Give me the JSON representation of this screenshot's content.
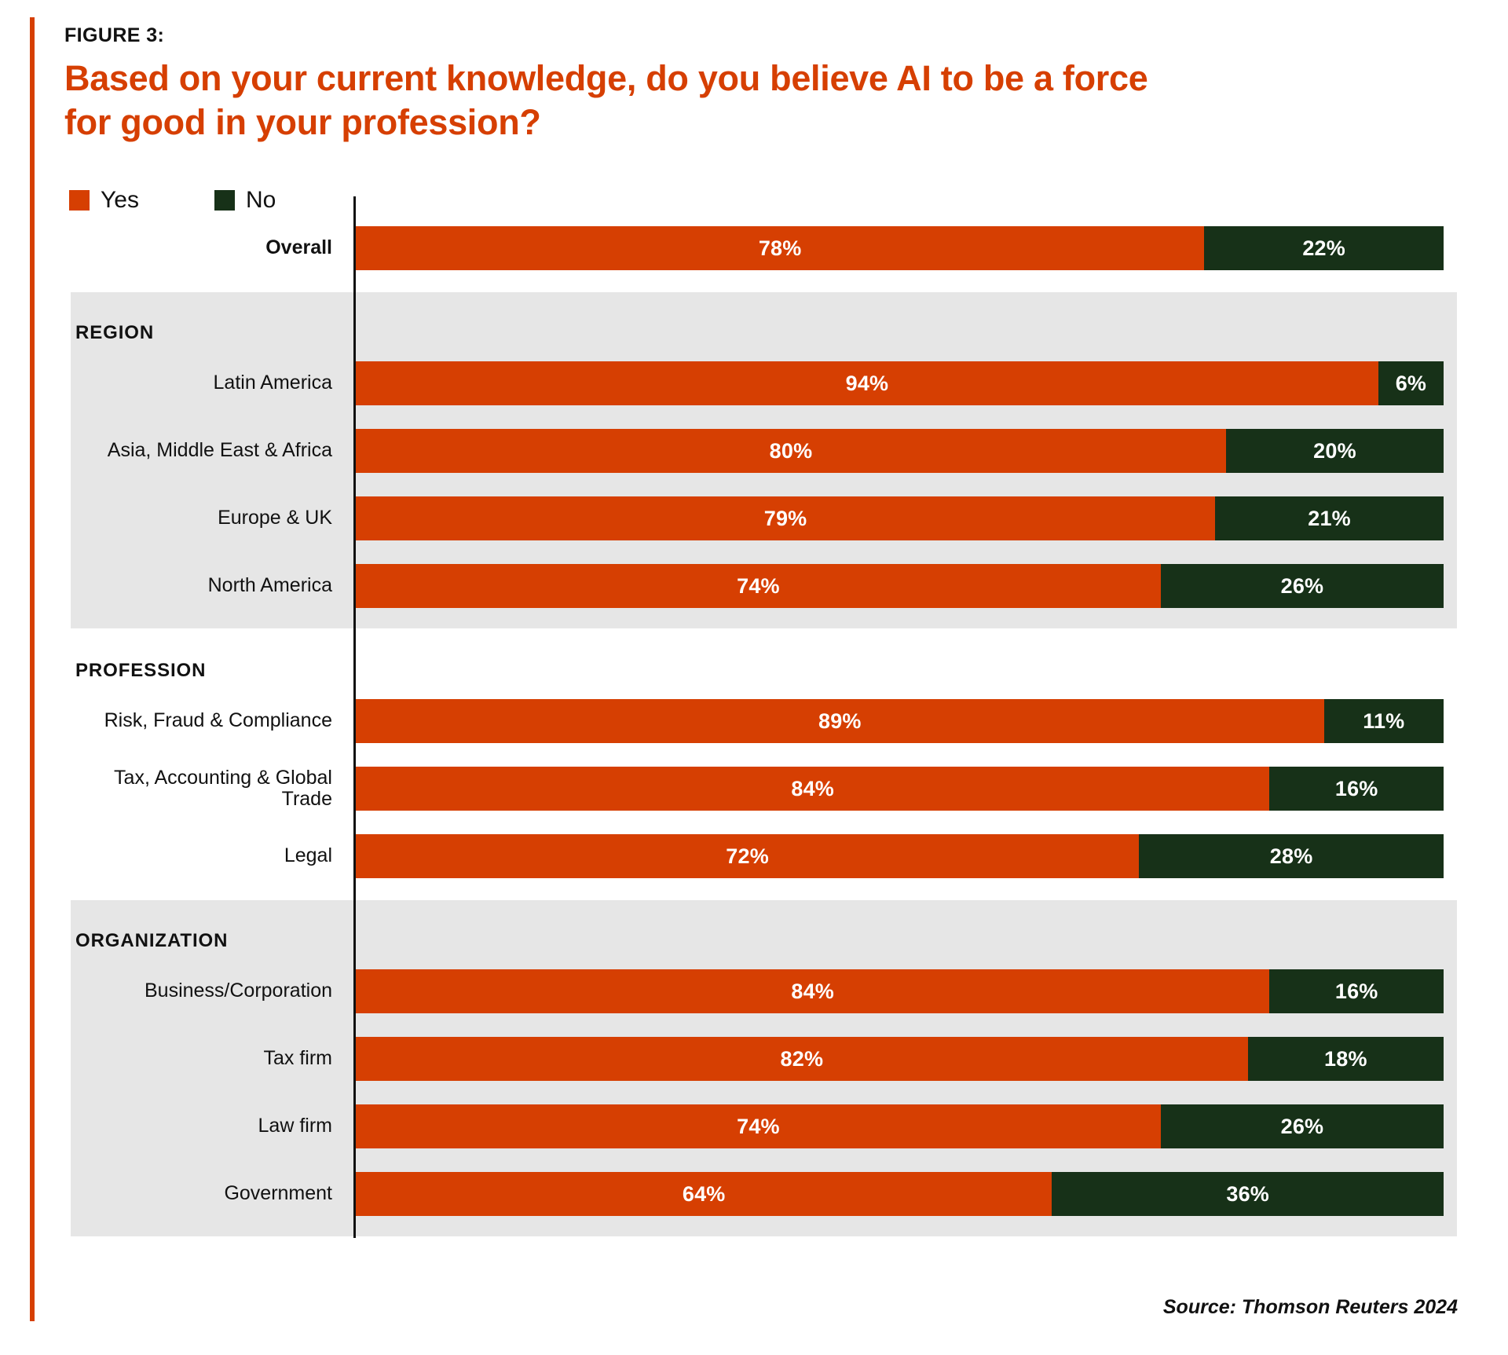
{
  "figure": {
    "kicker": "FIGURE 3:",
    "title": "Based on your current knowledge, do you believe AI to be a force for good in your profession?"
  },
  "legend": {
    "items": [
      {
        "label": "Yes",
        "color": "#D63F02",
        "swatch_name": "legend-swatch-yes"
      },
      {
        "label": "No",
        "color": "#173118",
        "swatch_name": "legend-swatch-no"
      }
    ]
  },
  "source": "Source: Thomson Reuters 2024",
  "colors": {
    "yes": "#D63F02",
    "no": "#173118",
    "accent": "#D63F02",
    "band": "#E6E6E6",
    "axis": "#111111"
  },
  "chart_data": {
    "type": "bar",
    "orientation": "horizontal",
    "stacked": true,
    "percent_stacked": true,
    "title": "Based on your current knowledge, do you believe AI to be a force for good in your profession?",
    "subtitle": "FIGURE 3:",
    "xlabel": "",
    "ylabel": "",
    "xlim": [
      0,
      100
    ],
    "grid": false,
    "legend_position": "top-left",
    "categories": [
      "Overall",
      "Latin America",
      "Asia, Middle East & Africa",
      "Europe & UK",
      "North America",
      "Risk, Fraud & Compliance",
      "Tax, Accounting & Global Trade",
      "Legal",
      "Business/Corporation",
      "Tax firm",
      "Law firm",
      "Government"
    ],
    "series": [
      {
        "name": "Yes",
        "color": "#D63F02",
        "values": [
          78,
          94,
          80,
          79,
          74,
          89,
          84,
          72,
          84,
          82,
          74,
          64
        ]
      },
      {
        "name": "No",
        "color": "#173118",
        "values": [
          22,
          6,
          20,
          21,
          26,
          11,
          16,
          28,
          16,
          18,
          26,
          36
        ]
      }
    ],
    "groups": [
      {
        "header": "",
        "shaded": false,
        "rows": [
          {
            "label": "Overall",
            "bold": true,
            "yes": 78,
            "no": 22,
            "yes_label": "78%",
            "no_label": "22%"
          }
        ]
      },
      {
        "header": "REGION",
        "shaded": true,
        "rows": [
          {
            "label": "Latin America",
            "bold": false,
            "yes": 94,
            "no": 6,
            "yes_label": "94%",
            "no_label": "6%"
          },
          {
            "label": "Asia, Middle East & Africa",
            "bold": false,
            "yes": 80,
            "no": 20,
            "yes_label": "80%",
            "no_label": "20%"
          },
          {
            "label": "Europe & UK",
            "bold": false,
            "yes": 79,
            "no": 21,
            "yes_label": "79%",
            "no_label": "21%"
          },
          {
            "label": "North America",
            "bold": false,
            "yes": 74,
            "no": 26,
            "yes_label": "74%",
            "no_label": "26%"
          }
        ]
      },
      {
        "header": "PROFESSION",
        "shaded": false,
        "rows": [
          {
            "label": "Risk, Fraud & Compliance",
            "bold": false,
            "yes": 89,
            "no": 11,
            "yes_label": "89%",
            "no_label": "11%"
          },
          {
            "label": "Tax, Accounting & Global Trade",
            "bold": false,
            "yes": 84,
            "no": 16,
            "yes_label": "84%",
            "no_label": "16%"
          },
          {
            "label": "Legal",
            "bold": false,
            "yes": 72,
            "no": 28,
            "yes_label": "72%",
            "no_label": "28%"
          }
        ]
      },
      {
        "header": "ORGANIZATION",
        "shaded": true,
        "rows": [
          {
            "label": "Business/Corporation",
            "bold": false,
            "yes": 84,
            "no": 16,
            "yes_label": "84%",
            "no_label": "16%"
          },
          {
            "label": "Tax firm",
            "bold": false,
            "yes": 82,
            "no": 18,
            "yes_label": "82%",
            "no_label": "18%"
          },
          {
            "label": "Law firm",
            "bold": false,
            "yes": 74,
            "no": 26,
            "yes_label": "74%",
            "no_label": "26%"
          },
          {
            "label": "Government",
            "bold": false,
            "yes": 64,
            "no": 36,
            "yes_label": "64%",
            "no_label": "36%"
          }
        ]
      }
    ]
  }
}
